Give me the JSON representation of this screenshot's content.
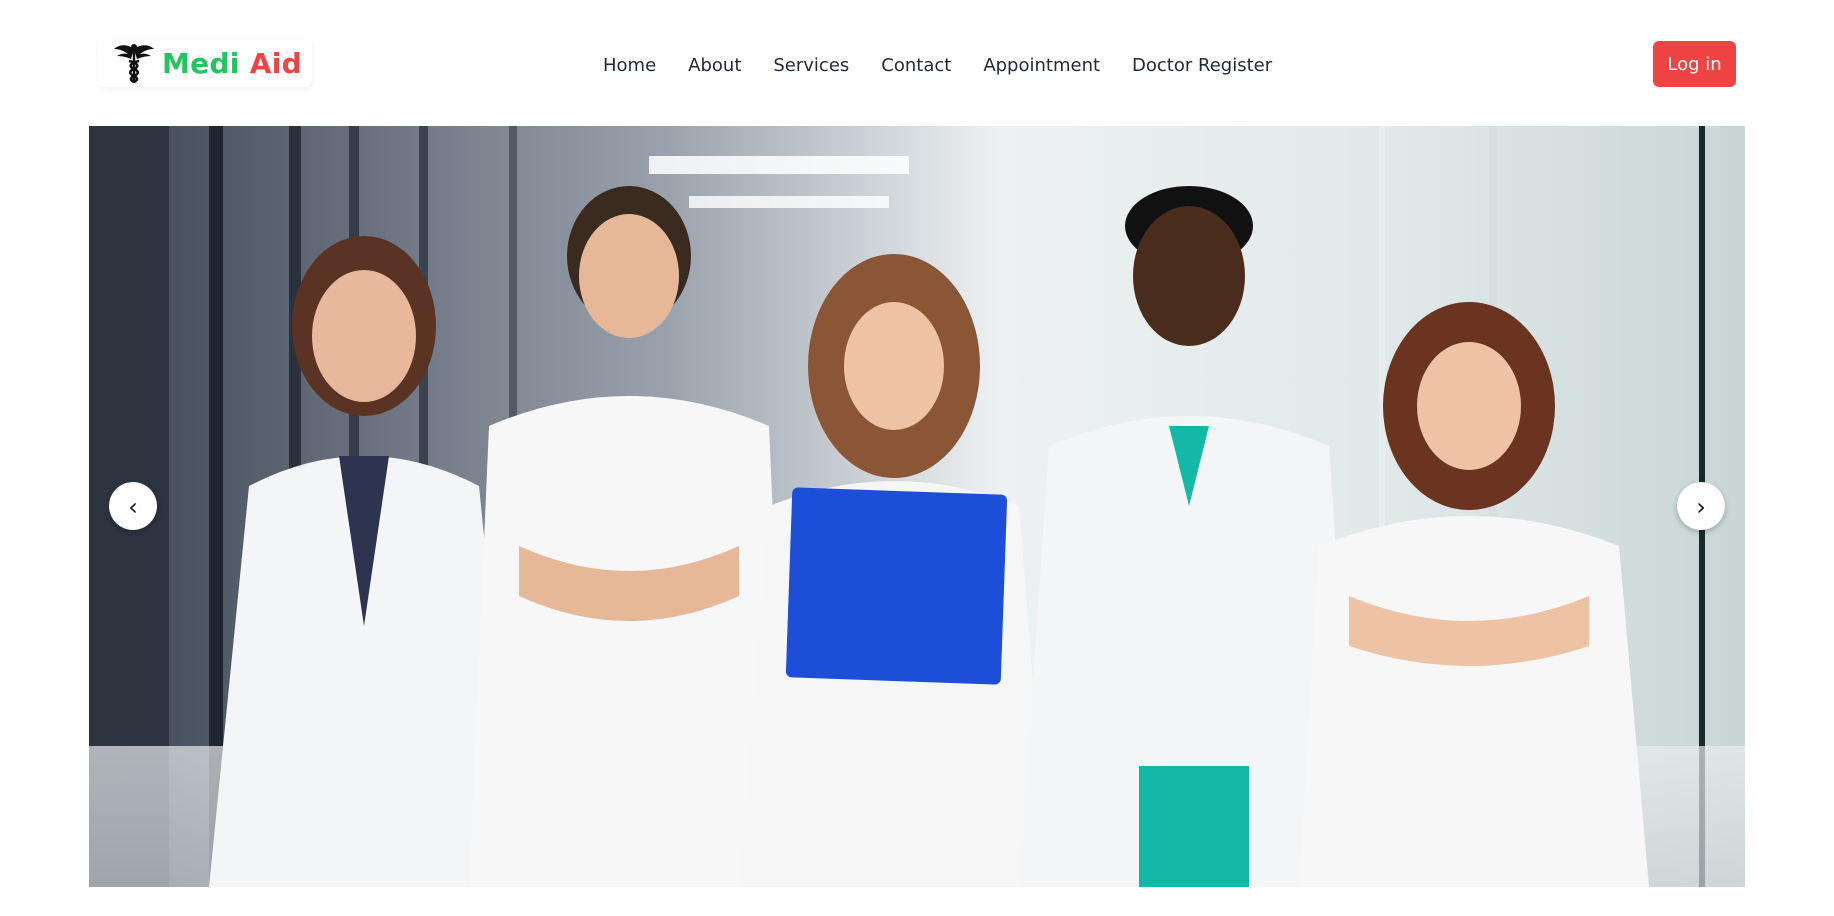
{
  "brand": {
    "name_part1": "Medi",
    "name_part2": "Aid",
    "color_part1": "#22c55e",
    "color_part2": "#ef4444",
    "logo_icon": "caduceus-icon"
  },
  "nav": {
    "items": [
      {
        "label": "Home"
      },
      {
        "label": "About"
      },
      {
        "label": "Services"
      },
      {
        "label": "Contact"
      },
      {
        "label": "Appointment"
      },
      {
        "label": "Doctor Register"
      }
    ]
  },
  "header": {
    "login_label": "Log in",
    "login_color": "#ef4444"
  },
  "hero": {
    "image_subject": "team of five doctors in white coats standing in hospital corridor",
    "prev_label": "‹",
    "next_label": "›"
  }
}
